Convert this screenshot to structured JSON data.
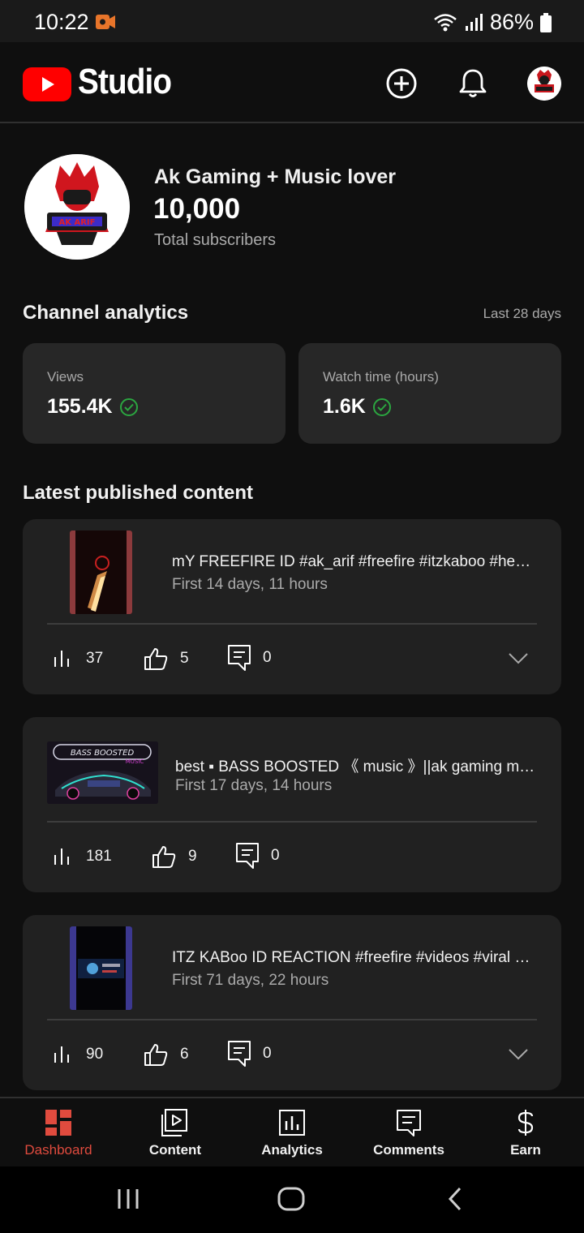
{
  "status_bar": {
    "time": "10:22",
    "battery": "86%"
  },
  "app_bar": {
    "title": "Studio",
    "icons": [
      "youtube-logo",
      "create-icon",
      "notifications-icon",
      "account-avatar"
    ]
  },
  "channel": {
    "name": "Ak Gaming + Music lover",
    "subscribers": "10,000",
    "subscribers_label": "Total subscribers"
  },
  "analytics": {
    "title": "Channel analytics",
    "period": "Last 28 days",
    "views_label": "Views",
    "views_value": "155.4K",
    "watch_label": "Watch time (hours)",
    "watch_value": "1.6K"
  },
  "latest": {
    "title": "Latest published content",
    "videos": [
      {
        "title": "mY FREEFIRE  ID #ak_arif #freefire #itzkaboo #headshot",
        "age": "First 14 days, 11 hours",
        "views": "37",
        "likes": "5",
        "comments": "0"
      },
      {
        "title": "best ▪ BASS BOOSTED 《 music 》||ak gaming music",
        "age": "First 17 days, 14 hours",
        "views": "181",
        "likes": "9",
        "comments": "0"
      },
      {
        "title": "ITZ KABoo ID REACTION #freefire #videos #viral #shorts",
        "age": "First 71 days, 22 hours",
        "views": "90",
        "likes": "6",
        "comments": "0"
      }
    ]
  },
  "bottom_nav": [
    {
      "label": "Dashboard",
      "icon": "dashboard-icon",
      "active": true
    },
    {
      "label": "Content",
      "icon": "content-icon"
    },
    {
      "label": "Analytics",
      "icon": "analytics-icon"
    },
    {
      "label": "Comments",
      "icon": "comments-icon"
    },
    {
      "label": "Earn",
      "icon": "earn-icon"
    }
  ],
  "colors": {
    "accent": "#e04b3e",
    "youtube_red": "#ff0000",
    "check_green": "#2ba640",
    "card": "#272727",
    "background": "#0f0f0f"
  }
}
